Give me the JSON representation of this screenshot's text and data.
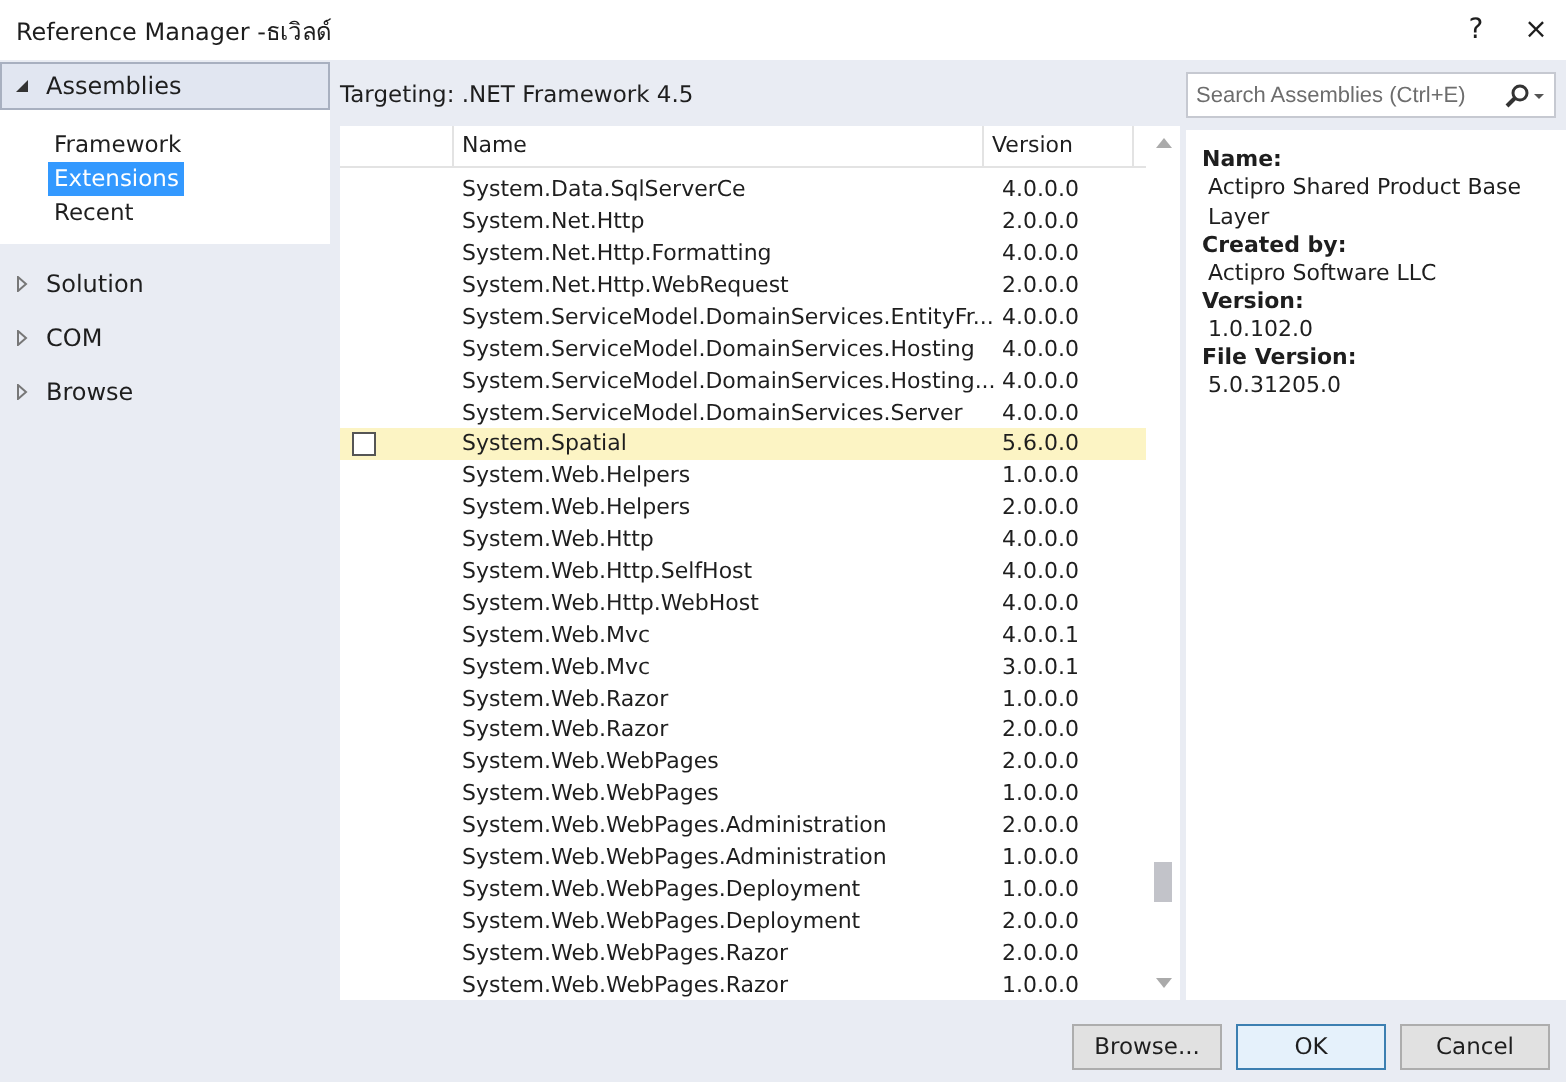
{
  "window": {
    "title": "Reference Manager -ธเวิลด์",
    "help": "?",
    "close": "×"
  },
  "sidebar": {
    "groups": [
      {
        "label": "Assemblies",
        "expanded": true,
        "selected": true,
        "children": [
          {
            "label": "Framework",
            "selected": false
          },
          {
            "label": "Extensions",
            "selected": true
          },
          {
            "label": "Recent",
            "selected": false
          }
        ]
      },
      {
        "label": "Solution",
        "expanded": false,
        "selected": false
      },
      {
        "label": "COM",
        "expanded": false,
        "selected": false
      },
      {
        "label": "Browse",
        "expanded": false,
        "selected": false
      }
    ]
  },
  "targeting": "Targeting: .NET Framework 4.5",
  "search": {
    "placeholder": "Search Assemblies (Ctrl+E)"
  },
  "table": {
    "columns": [
      "Name",
      "Version"
    ],
    "rows": [
      {
        "name": "System.Data.SqlServerCe",
        "version": "4.0.0.0",
        "selected": false,
        "checked": false
      },
      {
        "name": "System.Net.Http",
        "version": "2.0.0.0",
        "selected": false,
        "checked": false
      },
      {
        "name": "System.Net.Http.Formatting",
        "version": "4.0.0.0",
        "selected": false,
        "checked": false
      },
      {
        "name": "System.Net.Http.WebRequest",
        "version": "2.0.0.0",
        "selected": false,
        "checked": false
      },
      {
        "name": "System.ServiceModel.DomainServices.EntityFr...",
        "version": "4.0.0.0",
        "selected": false,
        "checked": false
      },
      {
        "name": "System.ServiceModel.DomainServices.Hosting",
        "version": "4.0.0.0",
        "selected": false,
        "checked": false
      },
      {
        "name": "System.ServiceModel.DomainServices.Hosting...",
        "version": "4.0.0.0",
        "selected": false,
        "checked": false
      },
      {
        "name": "System.ServiceModel.DomainServices.Server",
        "version": "4.0.0.0",
        "selected": false,
        "checked": false
      },
      {
        "name": "System.Spatial",
        "version": "5.6.0.0",
        "selected": true,
        "checked": false
      },
      {
        "name": "System.Web.Helpers",
        "version": "1.0.0.0",
        "selected": false,
        "checked": false
      },
      {
        "name": "System.Web.Helpers",
        "version": "2.0.0.0",
        "selected": false,
        "checked": false
      },
      {
        "name": "System.Web.Http",
        "version": "4.0.0.0",
        "selected": false,
        "checked": false
      },
      {
        "name": "System.Web.Http.SelfHost",
        "version": "4.0.0.0",
        "selected": false,
        "checked": false
      },
      {
        "name": "System.Web.Http.WebHost",
        "version": "4.0.0.0",
        "selected": false,
        "checked": false
      },
      {
        "name": "System.Web.Mvc",
        "version": "4.0.0.1",
        "selected": false,
        "checked": false
      },
      {
        "name": "System.Web.Mvc",
        "version": "3.0.0.1",
        "selected": false,
        "checked": false
      },
      {
        "name": "System.Web.Razor",
        "version": "1.0.0.0",
        "selected": false,
        "checked": false
      },
      {
        "name": "System.Web.Razor",
        "version": "2.0.0.0",
        "selected": false,
        "checked": false
      },
      {
        "name": "System.Web.WebPages",
        "version": "2.0.0.0",
        "selected": false,
        "checked": false
      },
      {
        "name": "System.Web.WebPages",
        "version": "1.0.0.0",
        "selected": false,
        "checked": false
      },
      {
        "name": "System.Web.WebPages.Administration",
        "version": "2.0.0.0",
        "selected": false,
        "checked": false
      },
      {
        "name": "System.Web.WebPages.Administration",
        "version": "1.0.0.0",
        "selected": false,
        "checked": false
      },
      {
        "name": "System.Web.WebPages.Deployment",
        "version": "1.0.0.0",
        "selected": false,
        "checked": false
      },
      {
        "name": "System.Web.WebPages.Deployment",
        "version": "2.0.0.0",
        "selected": false,
        "checked": false
      },
      {
        "name": "System.Web.WebPages.Razor",
        "version": "2.0.0.0",
        "selected": false,
        "checked": false
      },
      {
        "name": "System.Web.WebPages.Razor",
        "version": "1.0.0.0",
        "selected": false,
        "checked": false
      }
    ]
  },
  "details": [
    {
      "label": "Name:",
      "value": "Actipro Shared Product Base Layer"
    },
    {
      "label": "Created by:",
      "value": "Actipro Software LLC"
    },
    {
      "label": "Version:",
      "value": "1.0.102.0"
    },
    {
      "label": "File Version:",
      "value": "5.0.31205.0"
    }
  ],
  "buttons": [
    {
      "label": "Browse...",
      "default": false
    },
    {
      "label": "OK",
      "default": true
    },
    {
      "label": "Cancel",
      "default": false
    }
  ]
}
